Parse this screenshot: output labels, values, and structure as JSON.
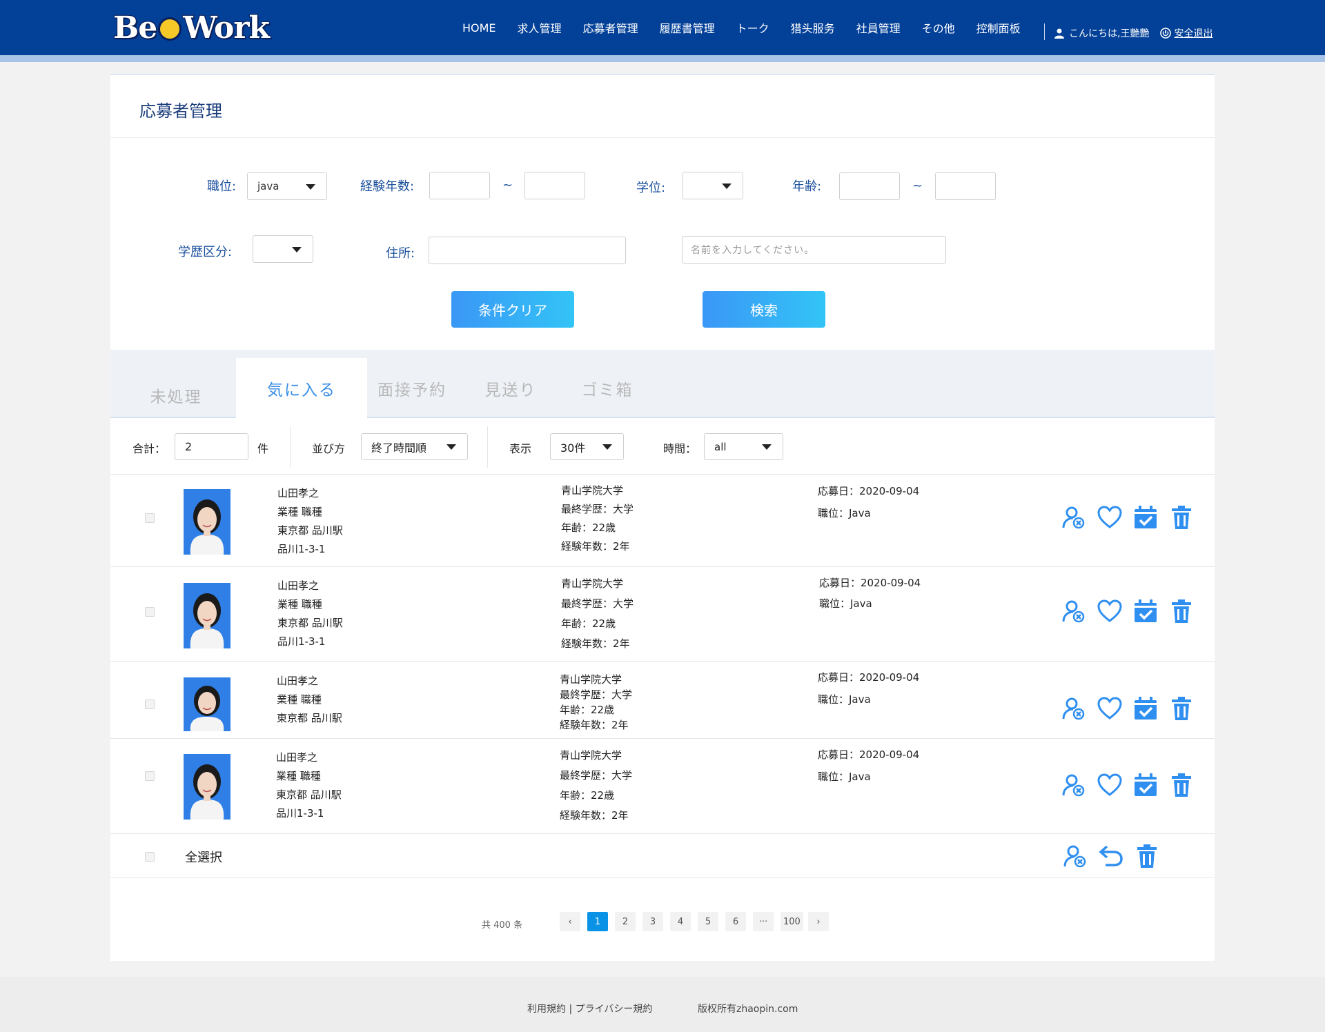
{
  "header": {
    "logo_text": "BeeWork",
    "nav": [
      "HOME",
      "求人管理",
      "応募者管理",
      "履歴書管理",
      "トーク",
      "猎头服务",
      "社員管理",
      "その他",
      "控制面板"
    ],
    "greeting": "こんにちは,王艷艷",
    "logout": "安全退出"
  },
  "page_title": "応募者管理",
  "filters": {
    "position_label": "職位:",
    "position_value": "java",
    "experience_label": "経験年数:",
    "tilde": "~",
    "degree_label": "学位:",
    "age_label": "年齢:",
    "edu_class_label": "学歴区分:",
    "address_label": "住所:",
    "name_placeholder": "名前を入力してください。",
    "clear_button": "条件クリア",
    "search_button": "検索"
  },
  "tabs": [
    {
      "label": "未処理",
      "active": false
    },
    {
      "label": "気に入る",
      "active": true
    },
    {
      "label": "面接予約",
      "active": false
    },
    {
      "label": "見送り",
      "active": false
    },
    {
      "label": "ゴミ箱",
      "active": false
    }
  ],
  "toolbar": {
    "total_label": "合計：",
    "total_value": "2",
    "total_unit": "件",
    "sort_label": "並び方",
    "sort_value": "終了時間順",
    "display_label": "表示",
    "display_value": "30件",
    "time_label": "時間：",
    "time_value": "all"
  },
  "applicants": [
    {
      "name": "山田孝之",
      "job": "業種  職種",
      "area": "東京都  品川駅",
      "address": "品川1-3-1",
      "school": "青山学院大学",
      "education": "最終学歴：大学",
      "age": "年齢：22歳",
      "experience": "経験年数：2年",
      "applied": "応募日：2020-09-04",
      "position": "職位：Java"
    },
    {
      "name": "山田孝之",
      "job": "業種  職種",
      "area": "東京都  品川駅",
      "address": "品川1-3-1",
      "school": "青山学院大学",
      "education": "最終学歴：大学",
      "age": "年齢：22歳",
      "experience": "経験年数：2年",
      "applied": "応募日：2020-09-04",
      "position": "職位：Java"
    },
    {
      "name": "山田孝之",
      "job": "業種  職種",
      "area": "東京都  品川駅",
      "address": "",
      "school": "青山学院大学",
      "education": "最終学歴：大学",
      "age": "年齢：22歳",
      "experience": "経験年数：2年",
      "applied": "応募日：2020-09-04",
      "position": "職位：Java"
    },
    {
      "name": "山田孝之",
      "job": "業種  職種",
      "area": "東京都  品川駅",
      "address": "品川1-3-1",
      "school": "青山学院大学",
      "education": "最終学歴：大学",
      "age": "年齢：22歳",
      "experience": "経験年数：2年",
      "applied": "応募日：2020-09-04",
      "position": "職位：Java"
    }
  ],
  "select_all_label": "全選択",
  "pagination": {
    "total": "共 400 条",
    "prev": "‹",
    "pages": [
      "1",
      "2",
      "3",
      "4",
      "5",
      "6",
      "···",
      "100"
    ],
    "next": "›",
    "current": "1"
  },
  "footer": {
    "links": "利用規約 | プライバシー規約",
    "copyright": "版权所有zhaopin.com"
  },
  "colors": {
    "header_bg": "#034098",
    "accent": "#3a8fe8",
    "icon_blue": "#2f8ff0"
  }
}
